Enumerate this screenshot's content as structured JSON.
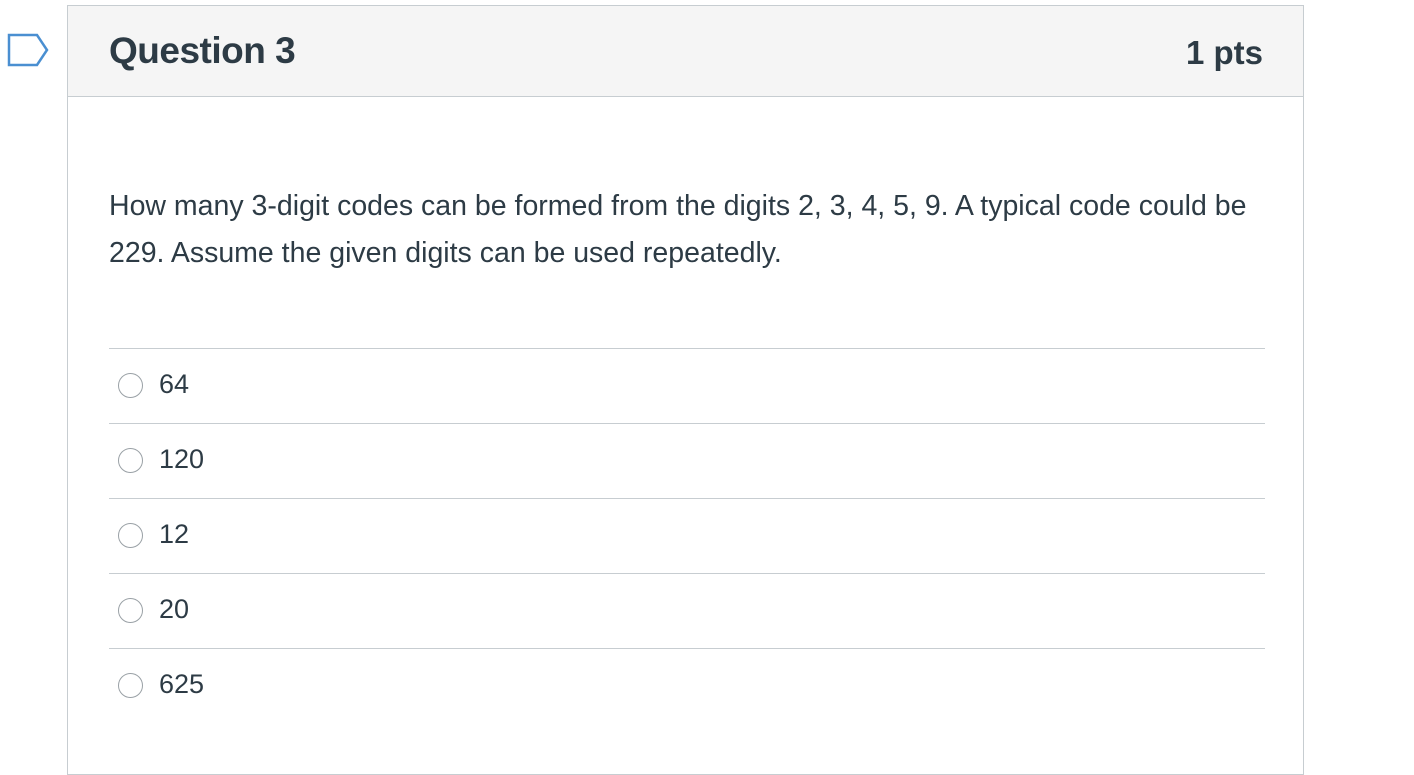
{
  "question": {
    "title": "Question 3",
    "points": "1 pts",
    "text": "How many 3-digit codes can be formed from the digits 2, 3, 4, 5, 9.  A typical code could be 229.  Assume the given digits can be used repeatedly.",
    "answers": [
      {
        "label": "64"
      },
      {
        "label": "120"
      },
      {
        "label": "12"
      },
      {
        "label": "20"
      },
      {
        "label": "625"
      }
    ]
  },
  "colors": {
    "text": "#2d3b45",
    "header_bg": "#f5f5f5",
    "border": "#c7cdd1",
    "flag_stroke": "#4a8fd1"
  },
  "icons": {
    "flag": "flag-question-icon",
    "radio": "radio-button-icon"
  }
}
